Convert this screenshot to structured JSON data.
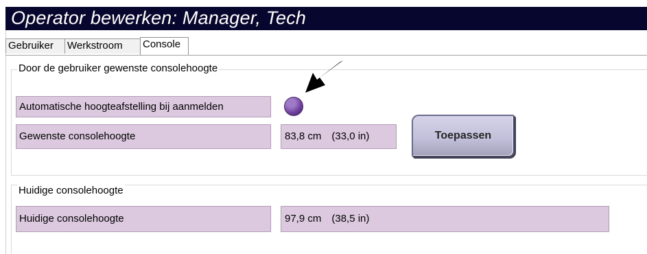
{
  "window": {
    "title": "Operator bewerken: Manager, Tech"
  },
  "tabs": [
    {
      "label": "Gebruiker",
      "active": false
    },
    {
      "label": "Werkstroom",
      "active": false
    },
    {
      "label": "Console",
      "active": true
    }
  ],
  "preferred_section": {
    "legend": "Door de gebruiker gewenste consolehoogte",
    "auto_height_label": "Automatische hoogteafstelling bij aanmelden",
    "auto_height_selected": true,
    "preferred_height_label": "Gewenste consolehoogte",
    "preferred_height_cm": "83,8 cm",
    "preferred_height_in": "(33,0 in)",
    "apply_button_label": "Toepassen"
  },
  "current_section": {
    "legend": "Huidige consolehoogte",
    "current_height_label": "Huidige consolehoogte",
    "current_height_cm": "97,9 cm",
    "current_height_in": "(38,5 in)"
  },
  "colors": {
    "titlebar": "#06062f",
    "field_background": "#dcc9df",
    "field_border": "#b39bb8",
    "radio": "#6b3d9a",
    "button": "#c2c0da"
  },
  "icons": {
    "callout": "arrow-icon",
    "option": "radio-icon"
  }
}
